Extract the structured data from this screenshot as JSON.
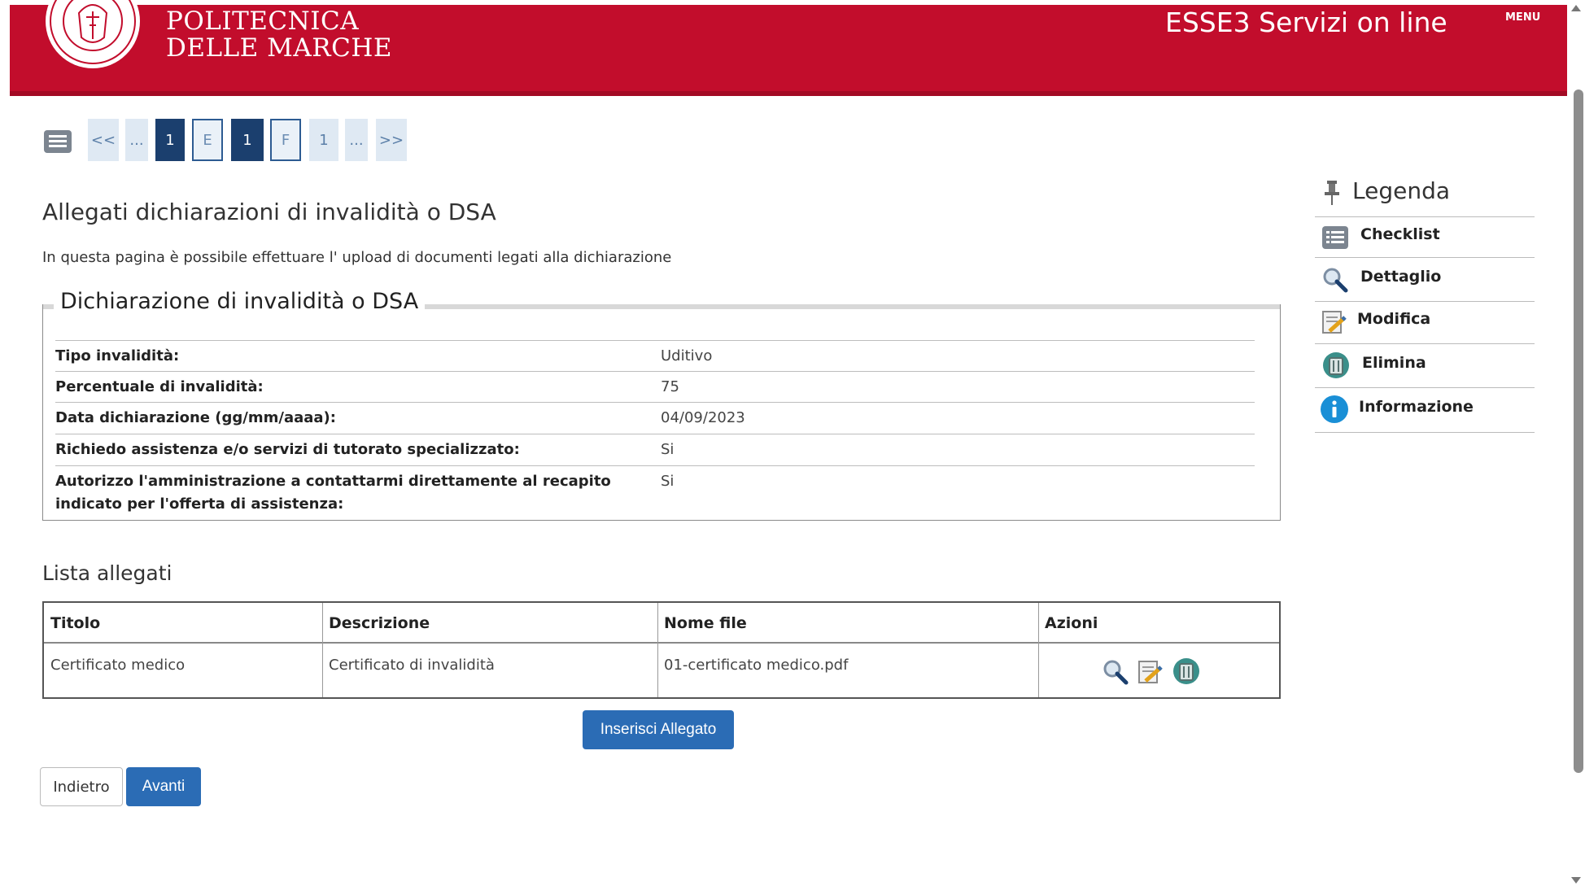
{
  "header": {
    "brand_line1": "POLITECNICA",
    "brand_line2": "DELLE MARCHE",
    "app_title": "ESSE3 Servizi on line",
    "menu_label": "MENU",
    "bg_color": "#c20d2c"
  },
  "pager": {
    "first": "<<",
    "ellipsis1": "...",
    "p1": "1",
    "pE": "E",
    "current": "1",
    "pF": "F",
    "p2": "1",
    "ellipsis2": "...",
    "last": ">>"
  },
  "page": {
    "title": "Allegati dichiarazioni di invalidità o DSA",
    "description": "In questa pagina è possibile effettuare l' upload di documenti legati alla dichiarazione"
  },
  "declaration": {
    "legend": "Dichiarazione di invalidità o DSA",
    "rows": [
      {
        "label": "Tipo invalidità:",
        "value": "Uditivo"
      },
      {
        "label": "Percentuale di invalidità:",
        "value": "75"
      },
      {
        "label": "Data dichiarazione (gg/mm/aaaa):",
        "value": "04/09/2023"
      },
      {
        "label": "Richiedo assistenza e/o servizi di tutorato specializzato:",
        "value": "Si"
      },
      {
        "label": "Autorizzo l'amministrazione a contattarmi direttamente al recapito indicato per l'offerta di assistenza:",
        "value": "Si"
      }
    ]
  },
  "attachments": {
    "heading": "Lista allegati",
    "columns": [
      "Titolo",
      "Descrizione",
      "Nome file",
      "Azioni"
    ],
    "rows": [
      {
        "title": "Certificato medico",
        "description": "Certificato di invalidità",
        "file": "01-certificato medico.pdf"
      }
    ],
    "actions": [
      "magnifier-icon",
      "edit-icon",
      "trash-icon"
    ]
  },
  "buttons": {
    "insert": "Inserisci Allegato",
    "back": "Indietro",
    "next": "Avanti",
    "primary_color": "#2b6cb5"
  },
  "legend": {
    "heading": "Legenda",
    "items": [
      {
        "label": "Checklist",
        "icon": "list-icon"
      },
      {
        "label": "Dettaglio",
        "icon": "magnifier-icon"
      },
      {
        "label": "Modifica",
        "icon": "edit-icon"
      },
      {
        "label": "Elimina",
        "icon": "trash-icon"
      },
      {
        "label": "Informazione",
        "icon": "info-icon"
      }
    ]
  }
}
